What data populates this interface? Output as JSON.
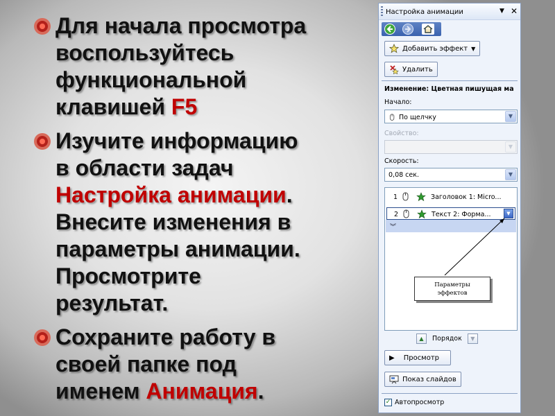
{
  "slide": {
    "bullets": [
      {
        "line1": "Для начала просмотра",
        "line2": "воспользуйтесь",
        "line3": "функциональной",
        "line4": "клавишей ",
        "highlight": "F5"
      },
      {
        "line1": "Изучите информацию",
        "line2": "в области задач",
        "highlight": "Настройка анимации",
        "after_highlight": ".",
        "line4": "Внесите изменения в",
        "line5": "параметры анимации.",
        "line6": "Просмотрите",
        "line7": "результат."
      },
      {
        "line1": "Сохраните работу в",
        "line2": "своей папке под",
        "line3": "именем ",
        "highlight": "Анимация",
        "after_highlight": "."
      }
    ]
  },
  "pane": {
    "title": "Настройка анимации",
    "add_effect": "Добавить эффект",
    "remove": "Удалить",
    "change_heading": "Изменение: Цветная пишущая ма",
    "start_label": "Начало:",
    "start_value": "По щелчку",
    "property_label": "Свойство:",
    "speed_label": "Скорость:",
    "speed_value": "0,08 сек.",
    "items": [
      {
        "num": "1",
        "text": "Заголовок 1: Micro..."
      },
      {
        "num": "2",
        "text": "Текст 2: Форма..."
      }
    ],
    "callout_line1": "Параметры",
    "callout_line2": "эффектов",
    "order_label": "Порядок",
    "preview": "Просмотр",
    "slideshow": "Показ слайдов",
    "autopreview": "Автопросмотр"
  },
  "colors": {
    "accent_red": "#c00000",
    "pane_bg": "#eef3fb",
    "selection_band": "#c7d6f2"
  }
}
